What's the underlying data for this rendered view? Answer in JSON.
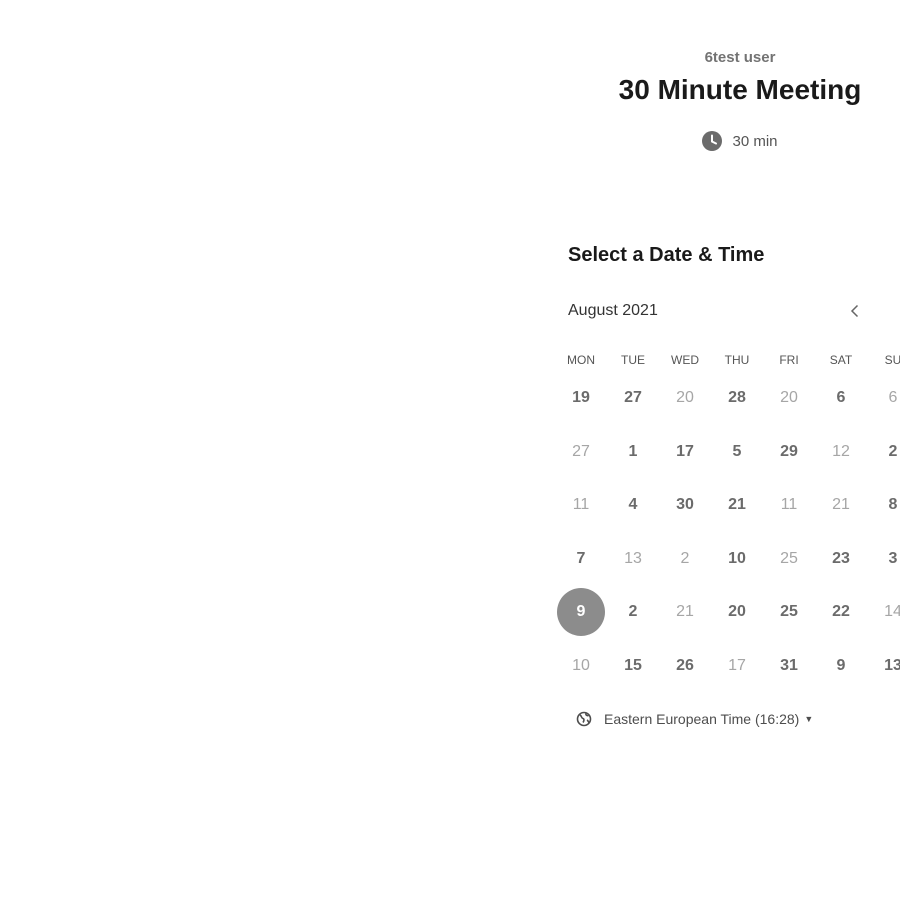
{
  "header": {
    "organizer": "6test user",
    "event_title": "30 Minute Meeting",
    "duration": "30 min",
    "duration_icon": "clock-icon"
  },
  "calendar": {
    "section_title": "Select a Date & Time",
    "month_label": "August 2021",
    "prev_icon": "chevron-left-icon",
    "weekdays": [
      "MON",
      "TUE",
      "WED",
      "THU",
      "FRI",
      "SAT",
      "SU"
    ],
    "selected_color": "#8c8c8c",
    "rows": [
      [
        {
          "label": "19",
          "available": true
        },
        {
          "label": "27",
          "available": true
        },
        {
          "label": "20",
          "available": false
        },
        {
          "label": "28",
          "available": true
        },
        {
          "label": "20",
          "available": false
        },
        {
          "label": "6",
          "available": true
        },
        {
          "label": "6",
          "available": false
        }
      ],
      [
        {
          "label": "27",
          "available": false
        },
        {
          "label": "1",
          "available": true
        },
        {
          "label": "17",
          "available": true
        },
        {
          "label": "5",
          "available": true
        },
        {
          "label": "29",
          "available": true
        },
        {
          "label": "12",
          "available": false
        },
        {
          "label": "2",
          "available": true
        }
      ],
      [
        {
          "label": "11",
          "available": false
        },
        {
          "label": "4",
          "available": true
        },
        {
          "label": "30",
          "available": true
        },
        {
          "label": "21",
          "available": true
        },
        {
          "label": "11",
          "available": false
        },
        {
          "label": "21",
          "available": false
        },
        {
          "label": "8",
          "available": true
        }
      ],
      [
        {
          "label": "7",
          "available": true
        },
        {
          "label": "13",
          "available": false
        },
        {
          "label": "2",
          "available": false
        },
        {
          "label": "10",
          "available": true
        },
        {
          "label": "25",
          "available": false
        },
        {
          "label": "23",
          "available": true
        },
        {
          "label": "3",
          "available": true
        }
      ],
      [
        {
          "label": "9",
          "available": true,
          "selected": true
        },
        {
          "label": "2",
          "available": true
        },
        {
          "label": "21",
          "available": false
        },
        {
          "label": "20",
          "available": true
        },
        {
          "label": "25",
          "available": true
        },
        {
          "label": "22",
          "available": true
        },
        {
          "label": "14",
          "available": false
        }
      ],
      [
        {
          "label": "10",
          "available": false
        },
        {
          "label": "15",
          "available": true
        },
        {
          "label": "26",
          "available": true
        },
        {
          "label": "17",
          "available": false
        },
        {
          "label": "31",
          "available": true
        },
        {
          "label": "9",
          "available": true
        },
        {
          "label": "13",
          "available": true
        }
      ]
    ]
  },
  "timezone": {
    "label": "Eastern European Time (16:28)",
    "icon": "globe-icon",
    "dropdown_icon": "caret-down-icon"
  }
}
